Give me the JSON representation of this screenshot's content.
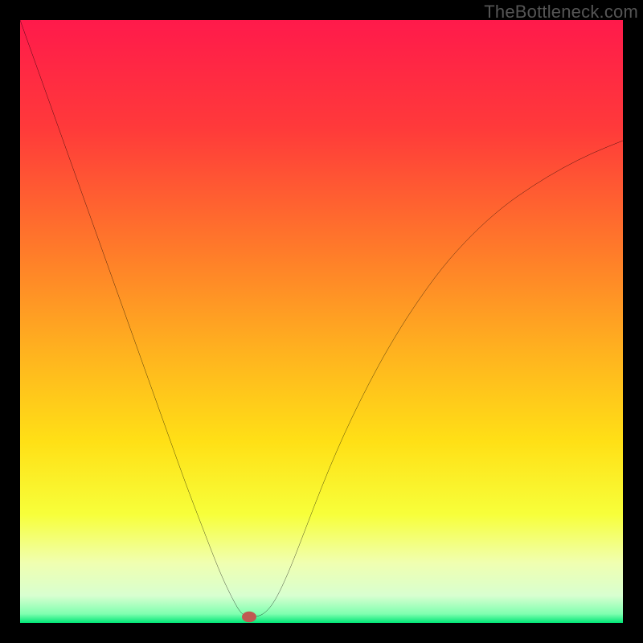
{
  "watermark": "TheBottleneck.com",
  "chart_data": {
    "type": "line",
    "title": "",
    "xlabel": "",
    "ylabel": "",
    "xlim": [
      0,
      100
    ],
    "ylim": [
      0,
      100
    ],
    "gradient_stops": [
      {
        "offset": 0.0,
        "color": "#ff1a4b"
      },
      {
        "offset": 0.18,
        "color": "#ff3a3a"
      },
      {
        "offset": 0.38,
        "color": "#ff7a2a"
      },
      {
        "offset": 0.55,
        "color": "#ffb21f"
      },
      {
        "offset": 0.7,
        "color": "#ffe016"
      },
      {
        "offset": 0.82,
        "color": "#f7ff3a"
      },
      {
        "offset": 0.9,
        "color": "#f0ffb0"
      },
      {
        "offset": 0.955,
        "color": "#d8ffd0"
      },
      {
        "offset": 0.985,
        "color": "#7fffb0"
      },
      {
        "offset": 1.0,
        "color": "#00e676"
      }
    ],
    "series": [
      {
        "name": "bottleneck-curve",
        "type": "line",
        "x": [
          0.0,
          2.5,
          5.0,
          7.5,
          10.0,
          12.5,
          15.0,
          17.5,
          20.0,
          22.5,
          25.0,
          27.5,
          30.0,
          32.5,
          34.0,
          35.5,
          36.5,
          37.5,
          38.5,
          40.0,
          41.5,
          43.0,
          45.0,
          47.5,
          50.0,
          52.5,
          55.0,
          58.0,
          61.0,
          65.0,
          70.0,
          75.0,
          80.0,
          85.0,
          90.0,
          95.0,
          100.0
        ],
        "y": [
          100.0,
          93.0,
          86.0,
          79.0,
          72.0,
          65.0,
          58.0,
          51.0,
          44.0,
          37.0,
          30.0,
          23.0,
          16.5,
          10.0,
          6.5,
          3.5,
          1.8,
          1.0,
          1.0,
          1.2,
          2.5,
          5.0,
          9.5,
          16.0,
          22.5,
          28.5,
          34.0,
          40.0,
          45.5,
          52.0,
          59.0,
          64.5,
          69.0,
          72.5,
          75.5,
          78.0,
          80.0
        ]
      }
    ],
    "marker": {
      "x": 38.0,
      "y": 1.0,
      "rx": 1.2,
      "ry": 0.9,
      "color": "#c05a52"
    }
  }
}
